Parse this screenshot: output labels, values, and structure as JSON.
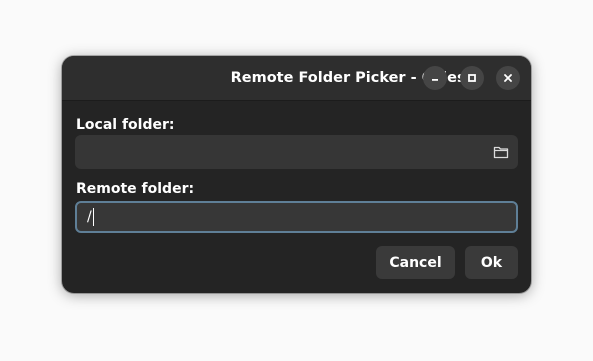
{
  "window": {
    "title": "Remote Folder Picker - Celeste",
    "controls": {
      "minimize_icon": "minimize-icon",
      "maximize_icon": "maximize-icon",
      "close_icon": "close-icon"
    }
  },
  "form": {
    "local_label": "Local folder:",
    "local_value": "",
    "local_browse_icon": "folder-icon",
    "remote_label": "Remote folder:",
    "remote_value": "/"
  },
  "actions": {
    "cancel_label": "Cancel",
    "ok_label": "Ok"
  },
  "colors": {
    "window_bg": "#242424",
    "titlebar_bg": "#2e2e2e",
    "field_bg": "#363636",
    "focus_border": "#5f7f97",
    "button_bg": "#3a3a3a",
    "text": "#ffffff"
  }
}
